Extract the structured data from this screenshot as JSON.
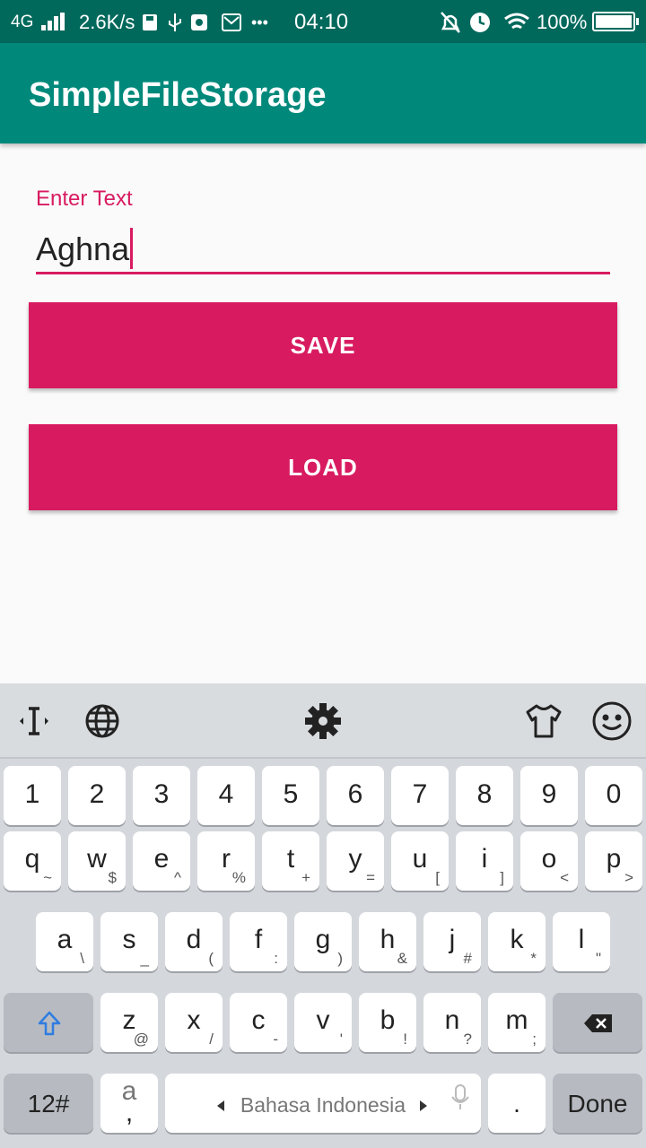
{
  "status_bar": {
    "network": "4G",
    "speed": "2.6K/s",
    "more": "•••",
    "time": "04:10",
    "battery": "100%",
    "icons_left": [
      "save-icon",
      "usb-icon",
      "vpn-icon",
      "mail-icon"
    ],
    "icons_right": [
      "alarm-off-icon",
      "alarm-icon",
      "wifi-icon"
    ]
  },
  "app_bar": {
    "title": "SimpleFileStorage"
  },
  "form": {
    "label": "Enter Text",
    "value": "Aghna",
    "save_label": "SAVE",
    "load_label": "LOAD"
  },
  "colors": {
    "primary": "#00897b",
    "primary_dark": "#00695c",
    "accent": "#d81b60"
  },
  "keyboard": {
    "toolbar_icons": [
      "cursor-icon",
      "globe-icon",
      "gear-icon",
      "shirt-icon",
      "emoji-icon"
    ],
    "row_numbers": [
      "1",
      "2",
      "3",
      "4",
      "5",
      "6",
      "7",
      "8",
      "9",
      "0"
    ],
    "row1": [
      {
        "k": "q",
        "s": "~"
      },
      {
        "k": "w",
        "s": "$"
      },
      {
        "k": "e",
        "s": "^"
      },
      {
        "k": "r",
        "s": "%"
      },
      {
        "k": "t",
        "s": "+"
      },
      {
        "k": "y",
        "s": "="
      },
      {
        "k": "u",
        "s": "["
      },
      {
        "k": "i",
        "s": "]"
      },
      {
        "k": "o",
        "s": "<"
      },
      {
        "k": "p",
        "s": ">"
      }
    ],
    "row2": [
      {
        "k": "a",
        "s": "\\"
      },
      {
        "k": "s",
        "s": "_"
      },
      {
        "k": "d",
        "s": "("
      },
      {
        "k": "f",
        "s": ":"
      },
      {
        "k": "g",
        "s": ")"
      },
      {
        "k": "h",
        "s": "&"
      },
      {
        "k": "j",
        "s": "#"
      },
      {
        "k": "k",
        "s": "*"
      },
      {
        "k": "l",
        "s": "\""
      }
    ],
    "row3": [
      {
        "k": "z",
        "s": "@"
      },
      {
        "k": "x",
        "s": "/"
      },
      {
        "k": "c",
        "s": "-"
      },
      {
        "k": "v",
        "s": "'"
      },
      {
        "k": "b",
        "s": "!"
      },
      {
        "k": "n",
        "s": "?"
      },
      {
        "k": "m",
        "s": ";"
      }
    ],
    "symbols_label": "12#",
    "comma_top": "a",
    "comma_bottom": ",",
    "space_label": "Bahasa Indonesia",
    "period": ".",
    "done_label": "Done"
  }
}
